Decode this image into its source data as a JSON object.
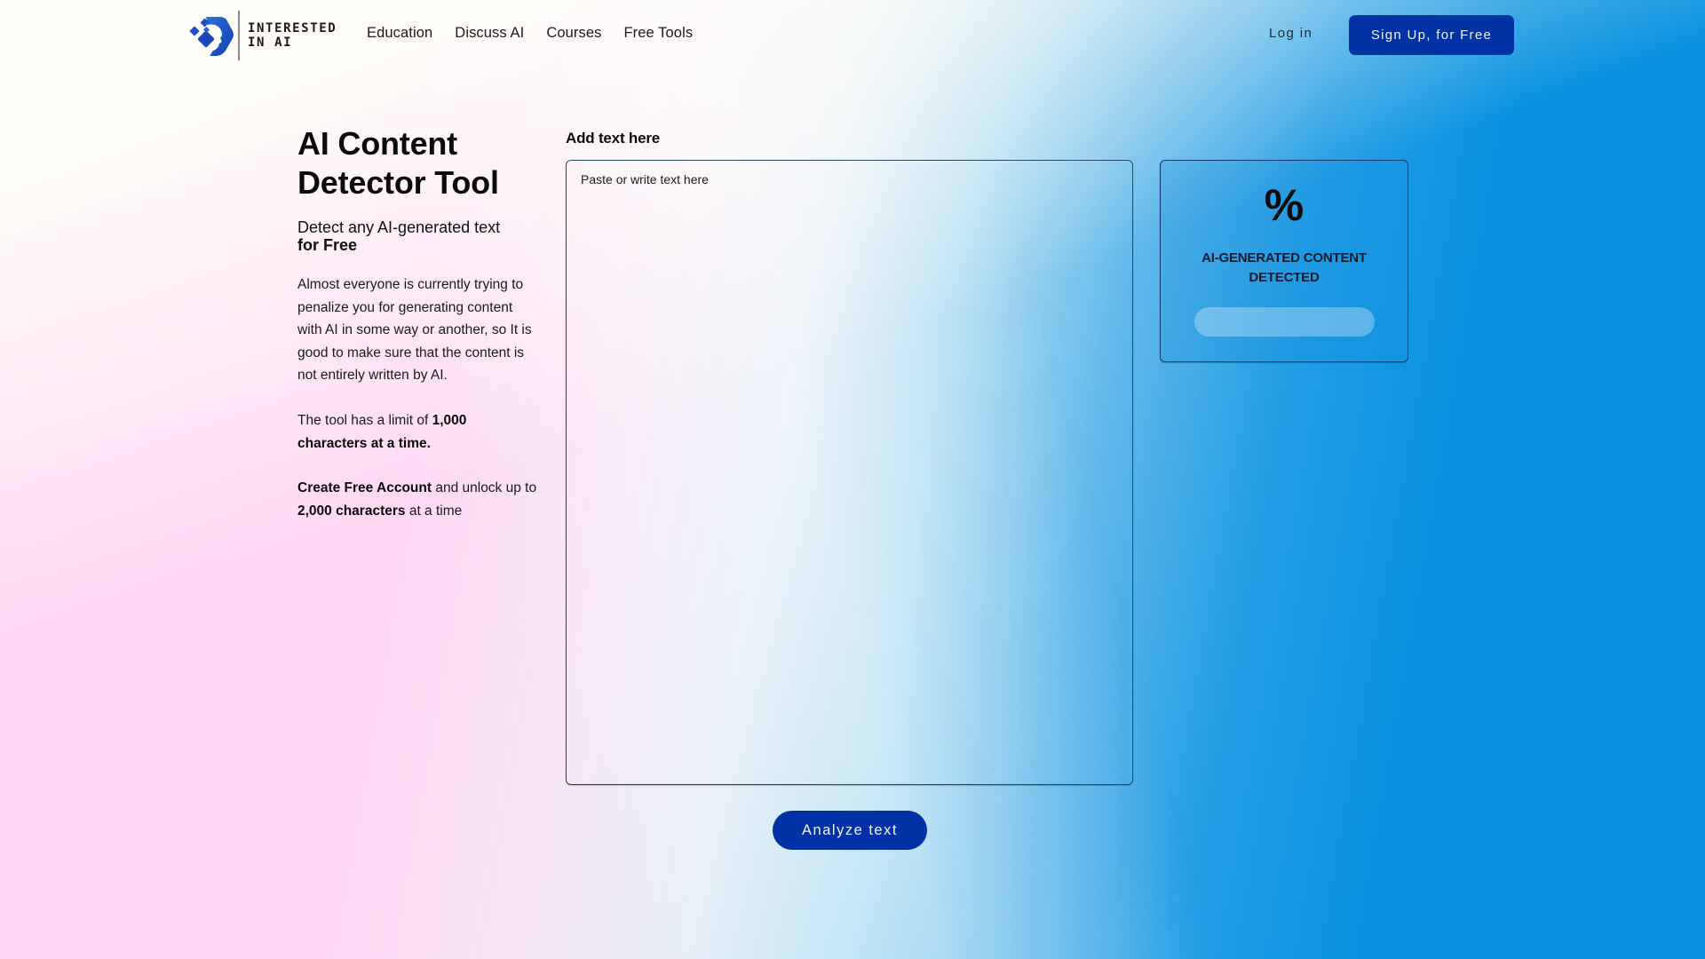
{
  "brand": {
    "name_line1": "INTERESTED",
    "name_line2": "IN AI",
    "logo_icon": "interested-in-ai-logo-icon",
    "colors": {
      "primary": "#0032a5",
      "logo_blue": "#1a4fc4",
      "background_blue": "#0892df",
      "background_pink": "#ffd6f3"
    }
  },
  "nav": {
    "items": [
      {
        "label": "Education"
      },
      {
        "label": "Discuss AI"
      },
      {
        "label": "Courses"
      },
      {
        "label": "Free Tools"
      }
    ],
    "login_label": "Log in",
    "signup_label": "Sign Up, for Free"
  },
  "intro": {
    "title": "AI Content Detector Tool",
    "subtitle_regular": "Detect any AI-generated text",
    "subtitle_bold": "for Free",
    "description": "Almost everyone is currently trying to penalize you for generating content with AI in some way or another, so It is good to make sure that the content is not entirely written by AI.",
    "limit_prefix": "The tool has a limit of ",
    "limit_bold": "1,000 characters at a time.",
    "upgrade_bold_1": "Create Free Account",
    "upgrade_mid": " and unlock up to ",
    "upgrade_bold_2": "2,000 characters",
    "upgrade_suffix": " at a time"
  },
  "editor": {
    "label": "Add text here",
    "placeholder": "Paste or write text here",
    "value": ""
  },
  "result": {
    "percent_value": "",
    "percent_symbol": "%",
    "label": "AI-GENERATED CONTENT DETECTED",
    "progress_fraction": 0
  },
  "actions": {
    "analyze_label": "Analyze text"
  }
}
